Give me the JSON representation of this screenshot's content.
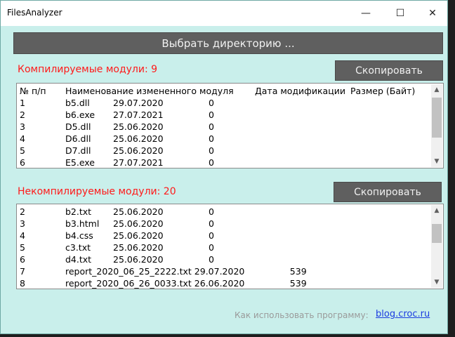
{
  "window": {
    "title": "FilesAnalyzer",
    "minimize": "—",
    "maximize": "☐",
    "close": "✕"
  },
  "select_dir_label": "Выбрать директорию ...",
  "compiled": {
    "label": "Компилируемые модули: 9",
    "copy_label": "Скопировать",
    "headers": [
      "№ п/п",
      "Наименование измененного модуля",
      "Дата модификации",
      "Размер (Байт)"
    ],
    "rows": [
      [
        "1",
        "b5.dll",
        "29.07.2020",
        "0"
      ],
      [
        "2",
        "b6.exe",
        "27.07.2021",
        "0"
      ],
      [
        "3",
        "D5.dll",
        "25.06.2020",
        "0"
      ],
      [
        "4",
        "D6.dll",
        "25.06.2020",
        "0"
      ],
      [
        "5",
        "D7.dll",
        "25.06.2020",
        "0"
      ],
      [
        "6",
        "E5.exe",
        "27.07.2021",
        "0"
      ]
    ]
  },
  "noncompiled": {
    "label": "Некомпилируемые модули: 20",
    "copy_label": "Скопировать",
    "rows": [
      [
        "2",
        "b2.txt",
        "25.06.2020",
        "0"
      ],
      [
        "3",
        "b3.html",
        "25.06.2020",
        "0"
      ],
      [
        "4",
        "b4.css",
        "25.06.2020",
        "0"
      ],
      [
        "5",
        "c3.txt",
        "25.06.2020",
        "0"
      ],
      [
        "6",
        "d4.txt",
        "25.06.2020",
        "0"
      ],
      [
        "7",
        "report_2020_06_25_2222.txt",
        "29.07.2020",
        "539"
      ],
      [
        "8",
        "report_2020_06_26_0033.txt",
        "26.06.2020",
        "539"
      ]
    ]
  },
  "footer": {
    "help_text": "Как использовать программу:",
    "link": "blog.croc.ru"
  }
}
